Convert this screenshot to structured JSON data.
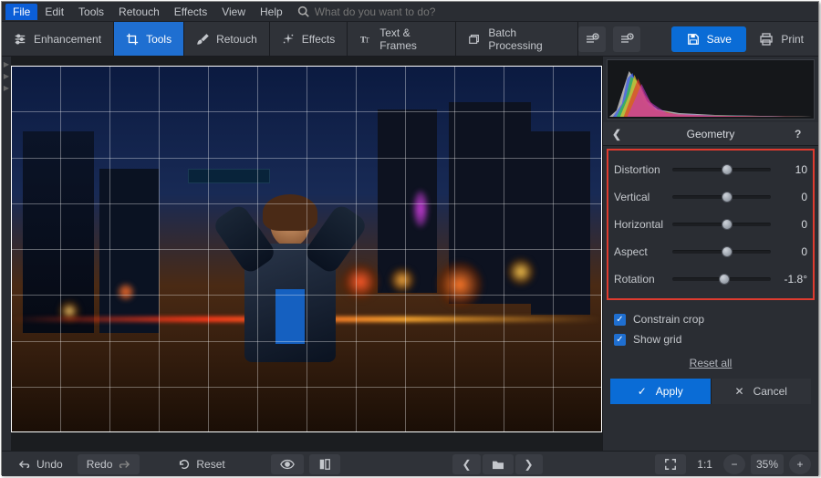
{
  "menu": {
    "items": [
      "File",
      "Edit",
      "Tools",
      "Retouch",
      "Effects",
      "View",
      "Help"
    ],
    "active_index": 0,
    "search_placeholder": "What do you want to do?"
  },
  "tabs": {
    "items": [
      {
        "label": "Enhancement",
        "icon": "sliders-icon"
      },
      {
        "label": "Tools",
        "icon": "crop-icon"
      },
      {
        "label": "Retouch",
        "icon": "brush-icon"
      },
      {
        "label": "Effects",
        "icon": "sparkle-icon"
      },
      {
        "label": "Text & Frames",
        "icon": "text-icon"
      },
      {
        "label": "Batch Processing",
        "icon": "stack-icon"
      }
    ],
    "active_index": 1
  },
  "header_right": {
    "save_label": "Save",
    "print_label": "Print"
  },
  "panel": {
    "title": "Geometry",
    "sliders": [
      {
        "label": "Distortion",
        "value": "10",
        "pos": 0.5
      },
      {
        "label": "Vertical",
        "value": "0",
        "pos": 0.5
      },
      {
        "label": "Horizontal",
        "value": "0",
        "pos": 0.5
      },
      {
        "label": "Aspect",
        "value": "0",
        "pos": 0.5
      },
      {
        "label": "Rotation",
        "value": "-1.8°",
        "pos": 0.47
      }
    ],
    "checkboxes": [
      {
        "label": "Constrain crop",
        "checked": true
      },
      {
        "label": "Show grid",
        "checked": true
      }
    ],
    "reset_label": "Reset all",
    "apply_label": "Apply",
    "cancel_label": "Cancel"
  },
  "bottombar": {
    "undo_label": "Undo",
    "redo_label": "Redo",
    "reset_label": "Reset",
    "zoom_ratio": "1:1",
    "zoom_percent": "35%"
  }
}
